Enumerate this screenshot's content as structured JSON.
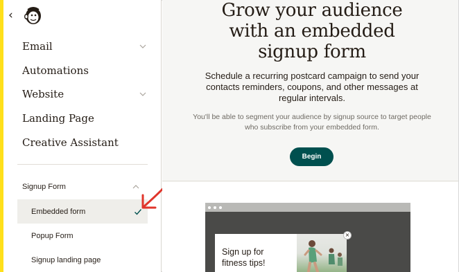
{
  "sidebar": {
    "back_icon": "chevron-left-icon",
    "logo": "mailchimp-freddie-logo",
    "nav": [
      {
        "label": "Email",
        "has_chevron": true
      },
      {
        "label": "Automations",
        "has_chevron": false
      },
      {
        "label": "Website",
        "has_chevron": true
      },
      {
        "label": "Landing Page",
        "has_chevron": false
      },
      {
        "label": "Creative Assistant",
        "has_chevron": false
      }
    ],
    "section_label": "Signup Form",
    "sub_items": [
      {
        "label": "Embedded form",
        "active": true
      },
      {
        "label": "Popup Form",
        "active": false
      },
      {
        "label": "Signup landing page",
        "active": false
      }
    ]
  },
  "main": {
    "headline_lines": [
      "Grow your audience",
      "with an embedded",
      "signup form"
    ],
    "subtext": "Schedule a recurring postcard campaign to send your contacts reminders, coupons, and other messages at regular intervals.",
    "smalltext": "You'll be able to segment your audience by signup source to target people who subscribe from your embedded form.",
    "begin_label": "Begin",
    "preview": {
      "popup_text": "Sign up for fitness tips!",
      "close_label": "×"
    }
  },
  "colors": {
    "accent_yellow": "#ffe01b",
    "button_teal": "#00504f",
    "annotation_red": "#e0352b",
    "check_teal": "#00504f"
  }
}
